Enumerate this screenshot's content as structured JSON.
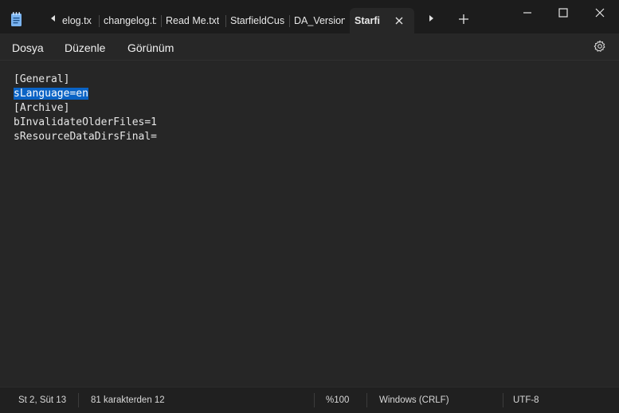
{
  "tabs": [
    {
      "label": "elog.tx"
    },
    {
      "label": "changelog.tx"
    },
    {
      "label": "Read Me.txt"
    },
    {
      "label": "StarfieldCust"
    },
    {
      "label": "DA_Version.t"
    },
    {
      "label": "Starfi"
    }
  ],
  "menu": {
    "file": "Dosya",
    "edit": "Düzenle",
    "view": "Görünüm"
  },
  "editor": {
    "lines": [
      "[General]",
      "sLanguage=en",
      "[Archive]",
      "bInvalidateOlderFiles=1",
      "sResourceDataDirsFinal="
    ],
    "selected_line_index": 1
  },
  "status": {
    "position": "St 2, Süt 13",
    "char_count": "81 karakterden 12",
    "zoom": "%100",
    "line_ending": "Windows (CRLF)",
    "encoding": "UTF-8"
  },
  "icons": {
    "app": "notepad-icon",
    "tab_scroll_left": "caret-left-icon",
    "tab_scroll_right": "caret-right-icon",
    "tab_close": "close-icon",
    "new_tab": "plus-icon",
    "minimize": "minimize-icon",
    "maximize": "maximize-icon",
    "close": "close-icon",
    "settings": "gear-icon"
  },
  "colors": {
    "selection": "#0a63c5",
    "background": "#202020",
    "editor": "#262626"
  }
}
